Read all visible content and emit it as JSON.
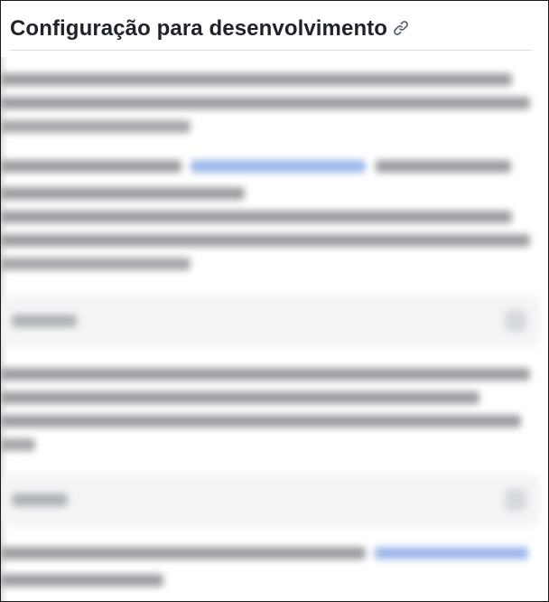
{
  "section": {
    "heading": "Configuração para desenvolvimento",
    "anchor_icon": "link-icon"
  },
  "content": {
    "blurred": true
  }
}
